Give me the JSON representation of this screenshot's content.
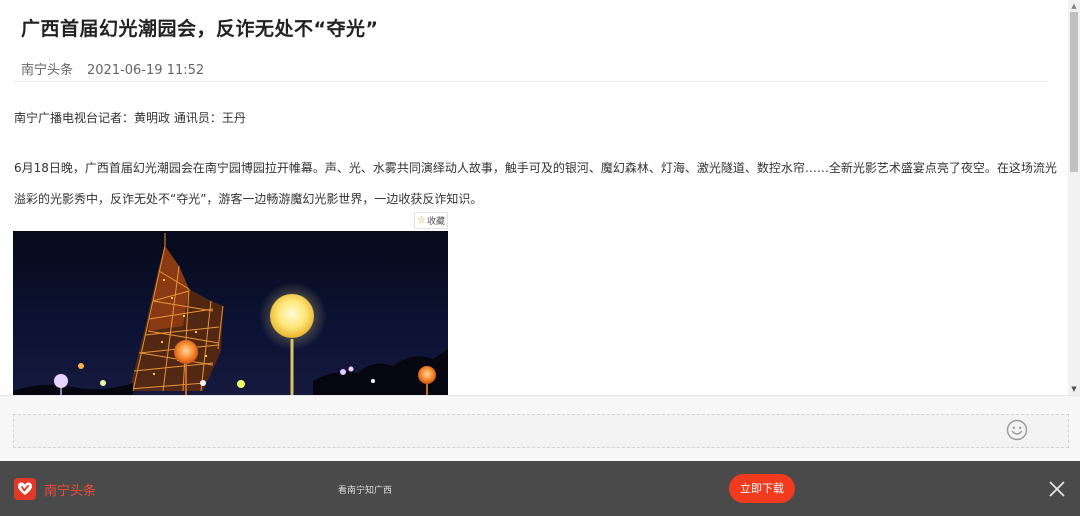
{
  "article": {
    "title": "广西首届幻光潮园会，反诈无处不“夺光”",
    "source": "南宁头条",
    "datetime": "2021-06-19 11:52",
    "byline": "南宁广播电视台记者：黄明政 通讯员：王丹",
    "paragraph": "6月18日晚，广西首届幻光潮园会在南宁园博园拉开帷幕。声、光、水雾共同演绎动人故事，触手可及的银河、魔幻森林、灯海、激光隧道、数控水帘……全新光影艺术盛宴点亮了夜空。在这场流光溢彩的光影秀中，反诈无处不“夺光”，游客一边畅游魔幻光影世界，一边收获反诈知识。",
    "favorite_label": "收藏"
  },
  "icons": {
    "favorite": "star-icon",
    "emoji": "smiley-icon",
    "close": "close-icon",
    "logo": "heart-logo-icon",
    "scroll_up": "scroll-up-icon",
    "scroll_down": "scroll-down-icon"
  },
  "bottom_bar": {
    "brand": "南宁头条",
    "slogan": "看南宁知广西",
    "download_label": "立即下载"
  },
  "colors": {
    "accent": "#f23a1f",
    "brand_red": "#e23a27",
    "bar_bg": "#4a4a4a"
  }
}
